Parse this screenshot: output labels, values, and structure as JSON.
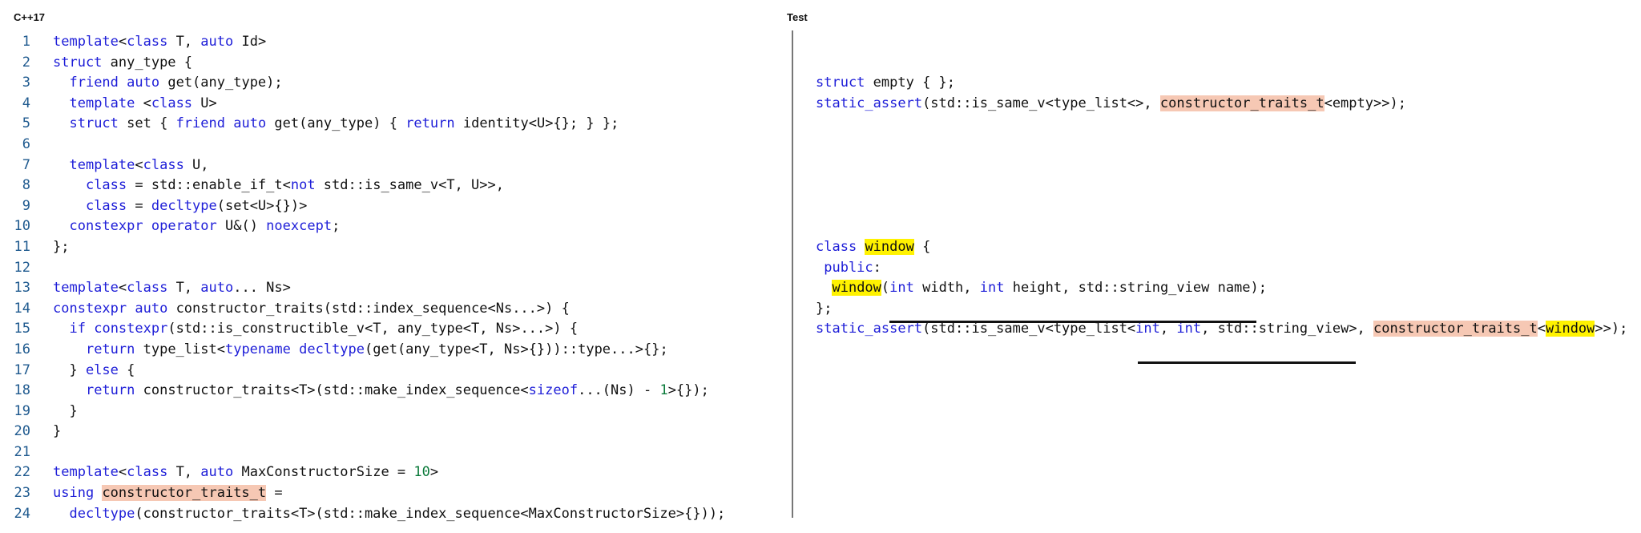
{
  "left_panel": {
    "title": "C++17",
    "line_numbers": [
      "1",
      "2",
      "3",
      "4",
      "5",
      "6",
      "7",
      "8",
      "9",
      "10",
      "11",
      "12",
      "13",
      "14",
      "15",
      "16",
      "17",
      "18",
      "19",
      "20",
      "21",
      "22",
      "23",
      "24"
    ],
    "lines": [
      [
        [
          "kw",
          "template"
        ],
        [
          "",
          "<"
        ],
        [
          "kw",
          "class"
        ],
        [
          "",
          " T, "
        ],
        [
          "kw",
          "auto"
        ],
        [
          "",
          " Id>"
        ]
      ],
      [
        [
          "kw",
          "struct"
        ],
        [
          "",
          " any_type {"
        ]
      ],
      [
        [
          "",
          "  "
        ],
        [
          "kw",
          "friend"
        ],
        [
          "",
          " "
        ],
        [
          "kw",
          "auto"
        ],
        [
          "",
          " get(any_type);"
        ]
      ],
      [
        [
          "",
          "  "
        ],
        [
          "kw",
          "template"
        ],
        [
          "",
          " <"
        ],
        [
          "kw",
          "class"
        ],
        [
          "",
          " U>"
        ]
      ],
      [
        [
          "",
          "  "
        ],
        [
          "kw",
          "struct"
        ],
        [
          "",
          " set { "
        ],
        [
          "kw",
          "friend"
        ],
        [
          "",
          " "
        ],
        [
          "kw",
          "auto"
        ],
        [
          "",
          " get(any_type) { "
        ],
        [
          "kw",
          "return"
        ],
        [
          "",
          " identity<U>{}; } };"
        ]
      ],
      [
        [
          "",
          ""
        ]
      ],
      [
        [
          "",
          "  "
        ],
        [
          "kw",
          "template"
        ],
        [
          "",
          "<"
        ],
        [
          "kw",
          "class"
        ],
        [
          "",
          " U,"
        ]
      ],
      [
        [
          "",
          "    "
        ],
        [
          "kw",
          "class"
        ],
        [
          "",
          " = std::enable_if_t<"
        ],
        [
          "kw",
          "not"
        ],
        [
          "",
          " std::is_same_v<T, U>>,"
        ]
      ],
      [
        [
          "",
          "    "
        ],
        [
          "kw",
          "class"
        ],
        [
          "",
          " = "
        ],
        [
          "kw",
          "decltype"
        ],
        [
          "",
          "(set<U>{})>"
        ]
      ],
      [
        [
          "",
          "  "
        ],
        [
          "kw",
          "constexpr"
        ],
        [
          "",
          " "
        ],
        [
          "kw",
          "operator"
        ],
        [
          "",
          " U&() "
        ],
        [
          "kw",
          "noexcept"
        ],
        [
          "",
          ";"
        ]
      ],
      [
        [
          "",
          "};"
        ]
      ],
      [
        [
          "",
          ""
        ]
      ],
      [
        [
          "kw",
          "template"
        ],
        [
          "",
          "<"
        ],
        [
          "kw",
          "class"
        ],
        [
          "",
          " T, "
        ],
        [
          "kw",
          "auto"
        ],
        [
          "",
          "... Ns>"
        ]
      ],
      [
        [
          "kw",
          "constexpr"
        ],
        [
          "",
          " "
        ],
        [
          "kw",
          "auto"
        ],
        [
          "",
          " constructor_traits(std::index_sequence<Ns...>) {"
        ]
      ],
      [
        [
          "",
          "  "
        ],
        [
          "kw",
          "if"
        ],
        [
          "",
          " "
        ],
        [
          "kw",
          "constexpr"
        ],
        [
          "",
          "(std::is_constructible_v<T, any_type<T, Ns>...>) {"
        ]
      ],
      [
        [
          "",
          "    "
        ],
        [
          "kw",
          "return"
        ],
        [
          "",
          " type_list<"
        ],
        [
          "kw",
          "typename"
        ],
        [
          "",
          " "
        ],
        [
          "kw",
          "decltype"
        ],
        [
          "",
          "(get(any_type<T, Ns>{}))::type...>{};"
        ]
      ],
      [
        [
          "",
          "  } "
        ],
        [
          "kw",
          "else"
        ],
        [
          "",
          " {"
        ]
      ],
      [
        [
          "",
          "    "
        ],
        [
          "kw",
          "return"
        ],
        [
          "",
          " constructor_traits<T>(std::make_index_sequence<"
        ],
        [
          "kw",
          "sizeof"
        ],
        [
          "",
          "...(Ns) - "
        ],
        [
          "num",
          "1"
        ],
        [
          "",
          ">{});"
        ]
      ],
      [
        [
          "",
          "  }"
        ]
      ],
      [
        [
          "",
          "}"
        ]
      ],
      [
        [
          "",
          ""
        ]
      ],
      [
        [
          "kw",
          "template"
        ],
        [
          "",
          "<"
        ],
        [
          "kw",
          "class"
        ],
        [
          "",
          " T, "
        ],
        [
          "kw",
          "auto"
        ],
        [
          "",
          " MaxConstructorSize = "
        ],
        [
          "num",
          "10"
        ],
        [
          "",
          ">"
        ]
      ],
      [
        [
          "kw",
          "using"
        ],
        [
          "",
          " "
        ],
        [
          "hl-orange",
          "constructor_traits_t"
        ],
        [
          "",
          " ="
        ]
      ],
      [
        [
          "",
          "  "
        ],
        [
          "kw",
          "decltype"
        ],
        [
          "",
          "(constructor_traits<T>(std::make_index_sequence<MaxConstructorSize>{}));"
        ]
      ]
    ]
  },
  "right_panel": {
    "title": "Test",
    "lines": [
      [
        [
          "",
          ""
        ]
      ],
      [
        [
          "",
          ""
        ]
      ],
      [
        [
          "kw",
          "struct"
        ],
        [
          "",
          " empty { };"
        ]
      ],
      [
        [
          "kw",
          "static_assert"
        ],
        [
          "",
          "(std::is_same_v<type_list<>, "
        ],
        [
          "hl-orange",
          "constructor_traits_t"
        ],
        [
          "",
          "<empty>>);"
        ]
      ],
      [
        [
          "",
          ""
        ]
      ],
      [
        [
          "",
          ""
        ]
      ],
      [
        [
          "",
          ""
        ]
      ],
      [
        [
          "",
          ""
        ]
      ],
      [
        [
          "",
          ""
        ]
      ],
      [
        [
          "",
          ""
        ]
      ],
      [
        [
          "kw",
          "class"
        ],
        [
          "",
          " "
        ],
        [
          "hl-yellow",
          "window"
        ],
        [
          "",
          " {"
        ]
      ],
      [
        [
          "",
          ""
        ],
        [
          "kw",
          " public"
        ],
        [
          "",
          ":"
        ]
      ],
      [
        [
          "",
          "  "
        ],
        [
          "hl-yellow",
          "window"
        ],
        [
          "",
          "("
        ],
        [
          "kw",
          "int"
        ],
        [
          "",
          " width, "
        ],
        [
          "kw",
          "int"
        ],
        [
          "",
          " height, std::string_view name);"
        ]
      ],
      [
        [
          "",
          "};"
        ]
      ],
      [
        [
          "kw",
          "static_assert"
        ],
        [
          "",
          "(std::is_same_v<type_list<"
        ],
        [
          "kw",
          "int"
        ],
        [
          "",
          ", "
        ],
        [
          "kw",
          "int"
        ],
        [
          "",
          ", std::string_view>, "
        ],
        [
          "hl-orange",
          "constructor_traits_t"
        ],
        [
          "",
          "<"
        ],
        [
          "hl-yellow",
          "window"
        ],
        [
          "",
          ">>);"
        ]
      ]
    ]
  },
  "colors": {
    "keyword": "#1e1ed8",
    "number": "#0a7a3a",
    "line_number": "#1f5a8f",
    "highlight_orange": "#f6c8b4",
    "highlight_yellow": "#fff200"
  }
}
